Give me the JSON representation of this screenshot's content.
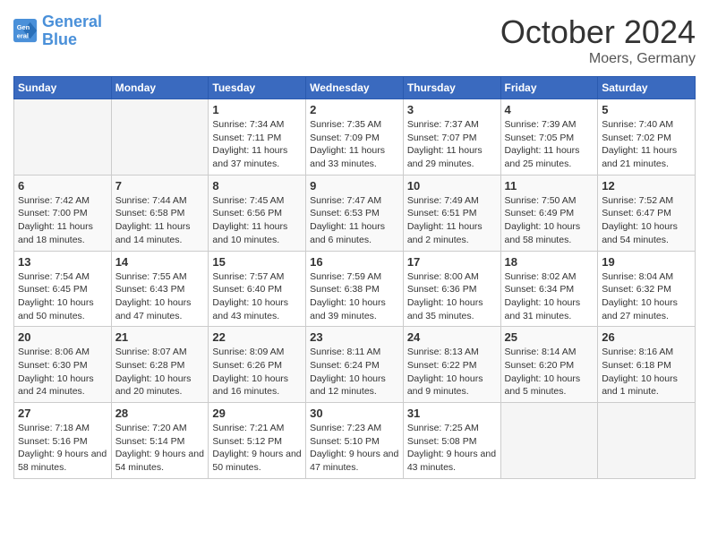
{
  "header": {
    "logo_line1": "General",
    "logo_line2": "Blue",
    "month": "October 2024",
    "location": "Moers, Germany"
  },
  "weekdays": [
    "Sunday",
    "Monday",
    "Tuesday",
    "Wednesday",
    "Thursday",
    "Friday",
    "Saturday"
  ],
  "weeks": [
    [
      {
        "day": "",
        "empty": true
      },
      {
        "day": "",
        "empty": true
      },
      {
        "day": "1",
        "sunrise": "7:34 AM",
        "sunset": "7:11 PM",
        "daylight": "11 hours and 37 minutes."
      },
      {
        "day": "2",
        "sunrise": "7:35 AM",
        "sunset": "7:09 PM",
        "daylight": "11 hours and 33 minutes."
      },
      {
        "day": "3",
        "sunrise": "7:37 AM",
        "sunset": "7:07 PM",
        "daylight": "11 hours and 29 minutes."
      },
      {
        "day": "4",
        "sunrise": "7:39 AM",
        "sunset": "7:05 PM",
        "daylight": "11 hours and 25 minutes."
      },
      {
        "day": "5",
        "sunrise": "7:40 AM",
        "sunset": "7:02 PM",
        "daylight": "11 hours and 21 minutes."
      }
    ],
    [
      {
        "day": "6",
        "sunrise": "7:42 AM",
        "sunset": "7:00 PM",
        "daylight": "11 hours and 18 minutes."
      },
      {
        "day": "7",
        "sunrise": "7:44 AM",
        "sunset": "6:58 PM",
        "daylight": "11 hours and 14 minutes."
      },
      {
        "day": "8",
        "sunrise": "7:45 AM",
        "sunset": "6:56 PM",
        "daylight": "11 hours and 10 minutes."
      },
      {
        "day": "9",
        "sunrise": "7:47 AM",
        "sunset": "6:53 PM",
        "daylight": "11 hours and 6 minutes."
      },
      {
        "day": "10",
        "sunrise": "7:49 AM",
        "sunset": "6:51 PM",
        "daylight": "11 hours and 2 minutes."
      },
      {
        "day": "11",
        "sunrise": "7:50 AM",
        "sunset": "6:49 PM",
        "daylight": "10 hours and 58 minutes."
      },
      {
        "day": "12",
        "sunrise": "7:52 AM",
        "sunset": "6:47 PM",
        "daylight": "10 hours and 54 minutes."
      }
    ],
    [
      {
        "day": "13",
        "sunrise": "7:54 AM",
        "sunset": "6:45 PM",
        "daylight": "10 hours and 50 minutes."
      },
      {
        "day": "14",
        "sunrise": "7:55 AM",
        "sunset": "6:43 PM",
        "daylight": "10 hours and 47 minutes."
      },
      {
        "day": "15",
        "sunrise": "7:57 AM",
        "sunset": "6:40 PM",
        "daylight": "10 hours and 43 minutes."
      },
      {
        "day": "16",
        "sunrise": "7:59 AM",
        "sunset": "6:38 PM",
        "daylight": "10 hours and 39 minutes."
      },
      {
        "day": "17",
        "sunrise": "8:00 AM",
        "sunset": "6:36 PM",
        "daylight": "10 hours and 35 minutes."
      },
      {
        "day": "18",
        "sunrise": "8:02 AM",
        "sunset": "6:34 PM",
        "daylight": "10 hours and 31 minutes."
      },
      {
        "day": "19",
        "sunrise": "8:04 AM",
        "sunset": "6:32 PM",
        "daylight": "10 hours and 27 minutes."
      }
    ],
    [
      {
        "day": "20",
        "sunrise": "8:06 AM",
        "sunset": "6:30 PM",
        "daylight": "10 hours and 24 minutes."
      },
      {
        "day": "21",
        "sunrise": "8:07 AM",
        "sunset": "6:28 PM",
        "daylight": "10 hours and 20 minutes."
      },
      {
        "day": "22",
        "sunrise": "8:09 AM",
        "sunset": "6:26 PM",
        "daylight": "10 hours and 16 minutes."
      },
      {
        "day": "23",
        "sunrise": "8:11 AM",
        "sunset": "6:24 PM",
        "daylight": "10 hours and 12 minutes."
      },
      {
        "day": "24",
        "sunrise": "8:13 AM",
        "sunset": "6:22 PM",
        "daylight": "10 hours and 9 minutes."
      },
      {
        "day": "25",
        "sunrise": "8:14 AM",
        "sunset": "6:20 PM",
        "daylight": "10 hours and 5 minutes."
      },
      {
        "day": "26",
        "sunrise": "8:16 AM",
        "sunset": "6:18 PM",
        "daylight": "10 hours and 1 minute."
      }
    ],
    [
      {
        "day": "27",
        "sunrise": "7:18 AM",
        "sunset": "5:16 PM",
        "daylight": "9 hours and 58 minutes."
      },
      {
        "day": "28",
        "sunrise": "7:20 AM",
        "sunset": "5:14 PM",
        "daylight": "9 hours and 54 minutes."
      },
      {
        "day": "29",
        "sunrise": "7:21 AM",
        "sunset": "5:12 PM",
        "daylight": "9 hours and 50 minutes."
      },
      {
        "day": "30",
        "sunrise": "7:23 AM",
        "sunset": "5:10 PM",
        "daylight": "9 hours and 47 minutes."
      },
      {
        "day": "31",
        "sunrise": "7:25 AM",
        "sunset": "5:08 PM",
        "daylight": "9 hours and 43 minutes."
      },
      {
        "day": "",
        "empty": true
      },
      {
        "day": "",
        "empty": true
      }
    ]
  ]
}
